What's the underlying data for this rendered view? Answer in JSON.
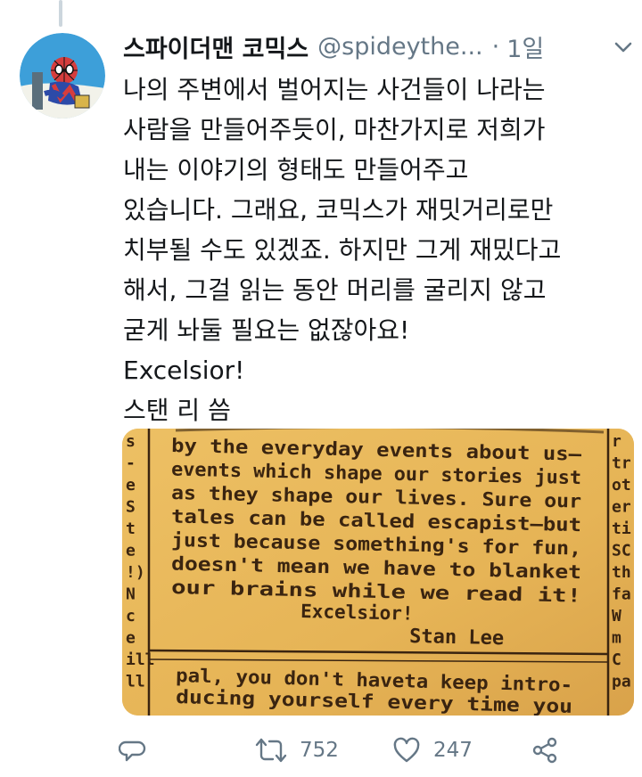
{
  "tweet": {
    "display_name": "스파이더맨 코믹스",
    "handle": "@spideythe...",
    "separator": "·",
    "time": "1일",
    "text_lines": [
      "나의 주변에서 벌어지는 사건들이 나라는",
      "사람을 만들어주듯이, 마찬가지로 저희가",
      "내는 이야기의 형태도 만들어주고",
      "있습니다. 그래요, 코믹스가 재밋거리로만",
      "치부될 수도 있겠죠. 하지만 그게 재밌다고",
      "해서, 그걸 읽는 동안 머리를 굴리지 않고",
      "굳게 놔둘 필요는 없잖아요!",
      "Excelsior!",
      "스탠 리 씀"
    ]
  },
  "media": {
    "left_margin_letters": [
      "s",
      "-",
      "e",
      "S",
      "t",
      "e",
      "!)",
      "N",
      "c",
      "e",
      "ill",
      "ll"
    ],
    "right_margin_letters": [
      "r",
      "tr",
      "ot",
      "er",
      "ti",
      "SC",
      "th",
      "fa",
      "W",
      "m",
      "C",
      "pa"
    ],
    "clip_lines": [
      "by the everyday events about us—",
      "events which shape our stories just",
      "as they shape our lives. Sure our",
      "tales can be called escapist—but",
      "just because something's for fun,",
      "doesn't mean we have to blanket",
      "our brains while we read it!"
    ],
    "closing": "Excelsior!",
    "signature": "Stan Lee",
    "lower_lines": [
      "pal, you don't haveta keep intro-",
      "ducing yourself every time you"
    ]
  },
  "actions": {
    "reply_icon": "reply-icon",
    "retweet_icon": "retweet-icon",
    "retweet_count": "752",
    "like_icon": "heart-icon",
    "like_count": "247",
    "share_icon": "share-icon"
  },
  "colors": {
    "text": "#14171a",
    "secondary": "#657786",
    "paper": "#e8b659",
    "ink": "#3a2410"
  }
}
